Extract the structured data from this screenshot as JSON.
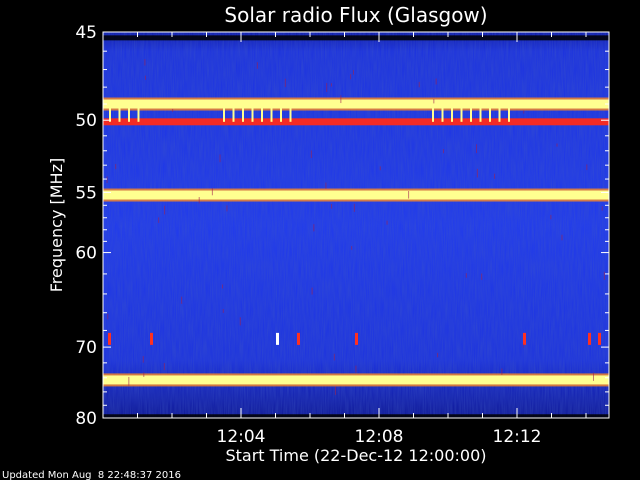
{
  "chart_data": {
    "type": "heatmap",
    "title": "Solar radio Flux (Glasgow)",
    "xlabel": "Start Time (22-Dec-12 12:00:00)",
    "ylabel": "Frequency [MHz]",
    "x_tick_labels": [
      "12:04",
      "12:08",
      "12:12"
    ],
    "y_tick_labels": [
      "45",
      "50",
      "55",
      "60",
      "70",
      "80"
    ],
    "y_axis": "reciprocal",
    "ylim": [
      45,
      80
    ],
    "xlim": [
      "12:00:00",
      "12:14:40"
    ],
    "x_tick_values": [
      "12:04:00",
      "12:08:00",
      "12:12:00"
    ],
    "y_tick_values": [
      45,
      50,
      55,
      60,
      70,
      80
    ],
    "colormap": [
      "#000000",
      "#000080",
      "#1428d0",
      "#2440ff",
      "#ff2020",
      "#ffff80",
      "#ffffff"
    ],
    "background_level": "blue",
    "bands": [
      {
        "freq_mhz": 45.3,
        "level": "dark"
      },
      {
        "freq_mhz": 49.0,
        "level": "yellow"
      },
      {
        "freq_mhz": 50.1,
        "level": "red"
      },
      {
        "freq_mhz": 55.2,
        "level": "yellow"
      },
      {
        "freq_mhz": 74.3,
        "level": "yellow"
      },
      {
        "freq_mhz": 79.8,
        "level": "dark"
      }
    ]
  },
  "footer": {
    "updated_text": "Updated Mon Aug  8 22:48:37 2016"
  }
}
